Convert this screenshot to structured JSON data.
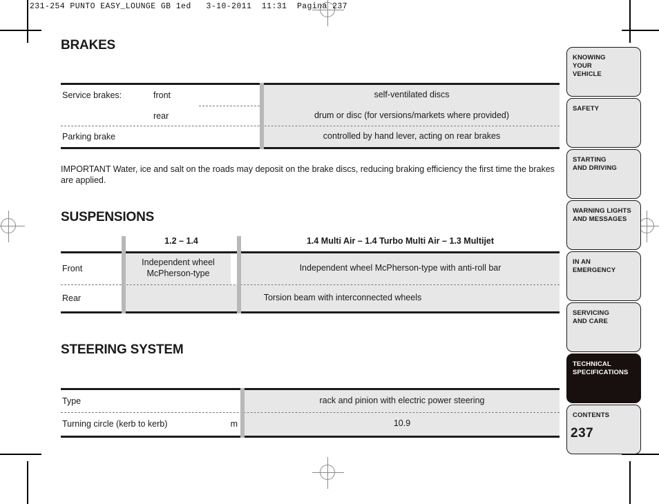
{
  "running_head": "231-254 PUNTO EASY_LOUNGE GB 1ed   3-10-2011  11:31  Pagina 237",
  "page_number": "237",
  "colors": {
    "cell_fill": "#e7e7e7",
    "separator_bar": "#b8b8b8",
    "rule": "#1a1a1a",
    "active_tab_bg": "#17100e",
    "tab_bg": "#e6e6e6"
  },
  "sections": {
    "brakes": {
      "heading": "BRAKES",
      "rows": [
        {
          "label": "Service brakes:",
          "sub": "front",
          "value": "self-ventilated discs"
        },
        {
          "label": "",
          "sub": "rear",
          "value": "drum or disc (for versions/markets where provided)"
        },
        {
          "label": "Parking brake",
          "sub": "",
          "value": "controlled by hand lever, acting on rear brakes"
        }
      ],
      "note": "IMPORTANT Water, ice and salt on the roads may deposit on the brake discs, reducing braking efficiency the first time the brakes are applied."
    },
    "suspensions": {
      "heading": "SUSPENSIONS",
      "column_headers": [
        "1.2 – 1.4",
        "1.4 Multi Air – 1.4 Turbo Multi Air – 1.3 Multijet"
      ],
      "rows": [
        {
          "label": "Front",
          "value_col1": "Independent wheel McPherson-type",
          "value_col2": "Independent wheel McPherson-type with anti-roll bar",
          "spans": false
        },
        {
          "label": "Rear",
          "value_span": "Torsion beam with interconnected wheels",
          "spans": true
        }
      ]
    },
    "steering": {
      "heading": "STEERING SYSTEM",
      "rows": [
        {
          "label": "Type",
          "unit": "",
          "value": "rack and pinion with electric power steering"
        },
        {
          "label": "Turning circle (kerb to kerb)",
          "unit": "m",
          "value": "10.9"
        }
      ]
    }
  },
  "thumb_tabs": [
    {
      "label": "KNOWING\nYOUR\nVEHICLE",
      "active": false
    },
    {
      "label": "SAFETY",
      "active": false
    },
    {
      "label": "STARTING\nAND DRIVING",
      "active": false
    },
    {
      "label": "WARNING LIGHTS\nAND MESSAGES",
      "active": false
    },
    {
      "label": "IN AN\nEMERGENCY",
      "active": false
    },
    {
      "label": "SERVICING\nAND CARE",
      "active": false
    },
    {
      "label": "TECHNICAL\nSPECIFICATIONS",
      "active": true
    },
    {
      "label": "CONTENTS",
      "active": false
    }
  ]
}
